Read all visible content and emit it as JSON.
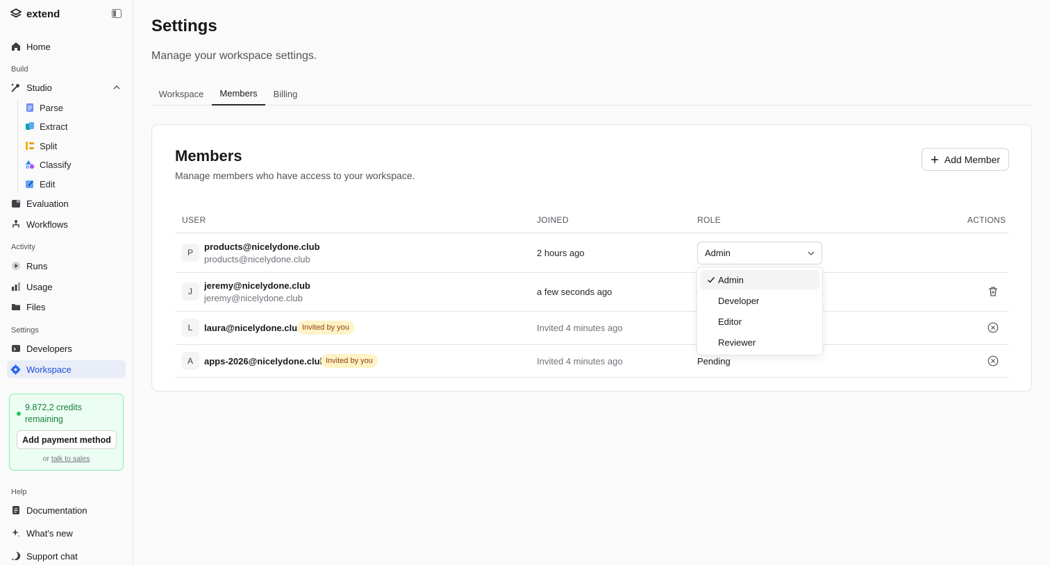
{
  "brand": {
    "name": "extend"
  },
  "sidebar": {
    "home": "Home",
    "build_label": "Build",
    "studio": "Studio",
    "studio_items": [
      "Parse",
      "Extract",
      "Split",
      "Classify",
      "Edit"
    ],
    "evaluation": "Evaluation",
    "workflows": "Workflows",
    "activity_label": "Activity",
    "runs": "Runs",
    "usage": "Usage",
    "files": "Files",
    "settings_label": "Settings",
    "developers": "Developers",
    "workspace": "Workspace",
    "help_label": "Help",
    "documentation": "Documentation",
    "whats_new": "What's new",
    "support_chat": "Support chat"
  },
  "credits": {
    "text": "9.872,2 credits remaining",
    "button": "Add payment method",
    "or": "or",
    "sales_link": "talk to sales"
  },
  "page": {
    "title": "Settings",
    "subtitle": "Manage your workspace settings."
  },
  "tabs": [
    "Workspace",
    "Members",
    "Billing"
  ],
  "members": {
    "title": "Members",
    "subtitle": "Manage members who have access to your workspace.",
    "add_button": "Add Member",
    "columns": {
      "user": "USER",
      "joined": "JOINED",
      "role": "ROLE",
      "actions": "ACTIONS"
    },
    "rows": [
      {
        "initial": "P",
        "name": "products@nicelydone.club",
        "email": "products@nicelydone.club",
        "joined": "2 hours ago",
        "role": "Admin"
      },
      {
        "initial": "J",
        "name": "jeremy@nicelydone.club",
        "email": "jeremy@nicelydone.club",
        "joined": "a few seconds ago"
      },
      {
        "initial": "L",
        "name": "laura@nicelydone.club",
        "badge": "Invited by you",
        "joined": "Invited 4 minutes ago"
      },
      {
        "initial": "A",
        "name": "apps-2026@nicelydone.club",
        "badge": "Invited by you",
        "joined": "Invited 4 minutes ago",
        "role": "Pending"
      }
    ]
  },
  "role_dropdown": {
    "options": [
      "Admin",
      "Developer",
      "Editor",
      "Reviewer"
    ],
    "selected": "Admin"
  },
  "colors": {
    "accent": "#1d4ed8",
    "credits_green": "#15803d",
    "badge_bg": "#fef3c7"
  }
}
